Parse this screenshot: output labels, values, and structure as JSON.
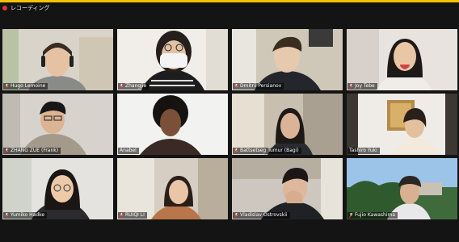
{
  "recording": {
    "label": "レコーディング"
  },
  "participants": [
    {
      "name": "Hugo Lemoine",
      "muted": true
    },
    {
      "name": "Zhangjie",
      "muted": true
    },
    {
      "name": "Dmitrii Persianov",
      "muted": true
    },
    {
      "name": "Joy Tebe",
      "muted": true
    },
    {
      "name": "ZHANG ZUE (Frank)",
      "muted": true
    },
    {
      "name": "Anabel",
      "muted": false
    },
    {
      "name": "Battsetseg Tumur (Bagi)",
      "muted": true
    },
    {
      "name": "Tashiro Yuki",
      "muted": false
    },
    {
      "name": "Yumiko Hadke",
      "muted": true
    },
    {
      "name": "RUIQI LI",
      "muted": true
    },
    {
      "name": "Vladislav Ostrovskii",
      "muted": true
    },
    {
      "name": "Fujio Kawashima",
      "muted": true
    }
  ],
  "colors": {
    "accent_border": "#f5c400",
    "active_speaker": "#a7d930",
    "mute_red": "#e03131"
  }
}
